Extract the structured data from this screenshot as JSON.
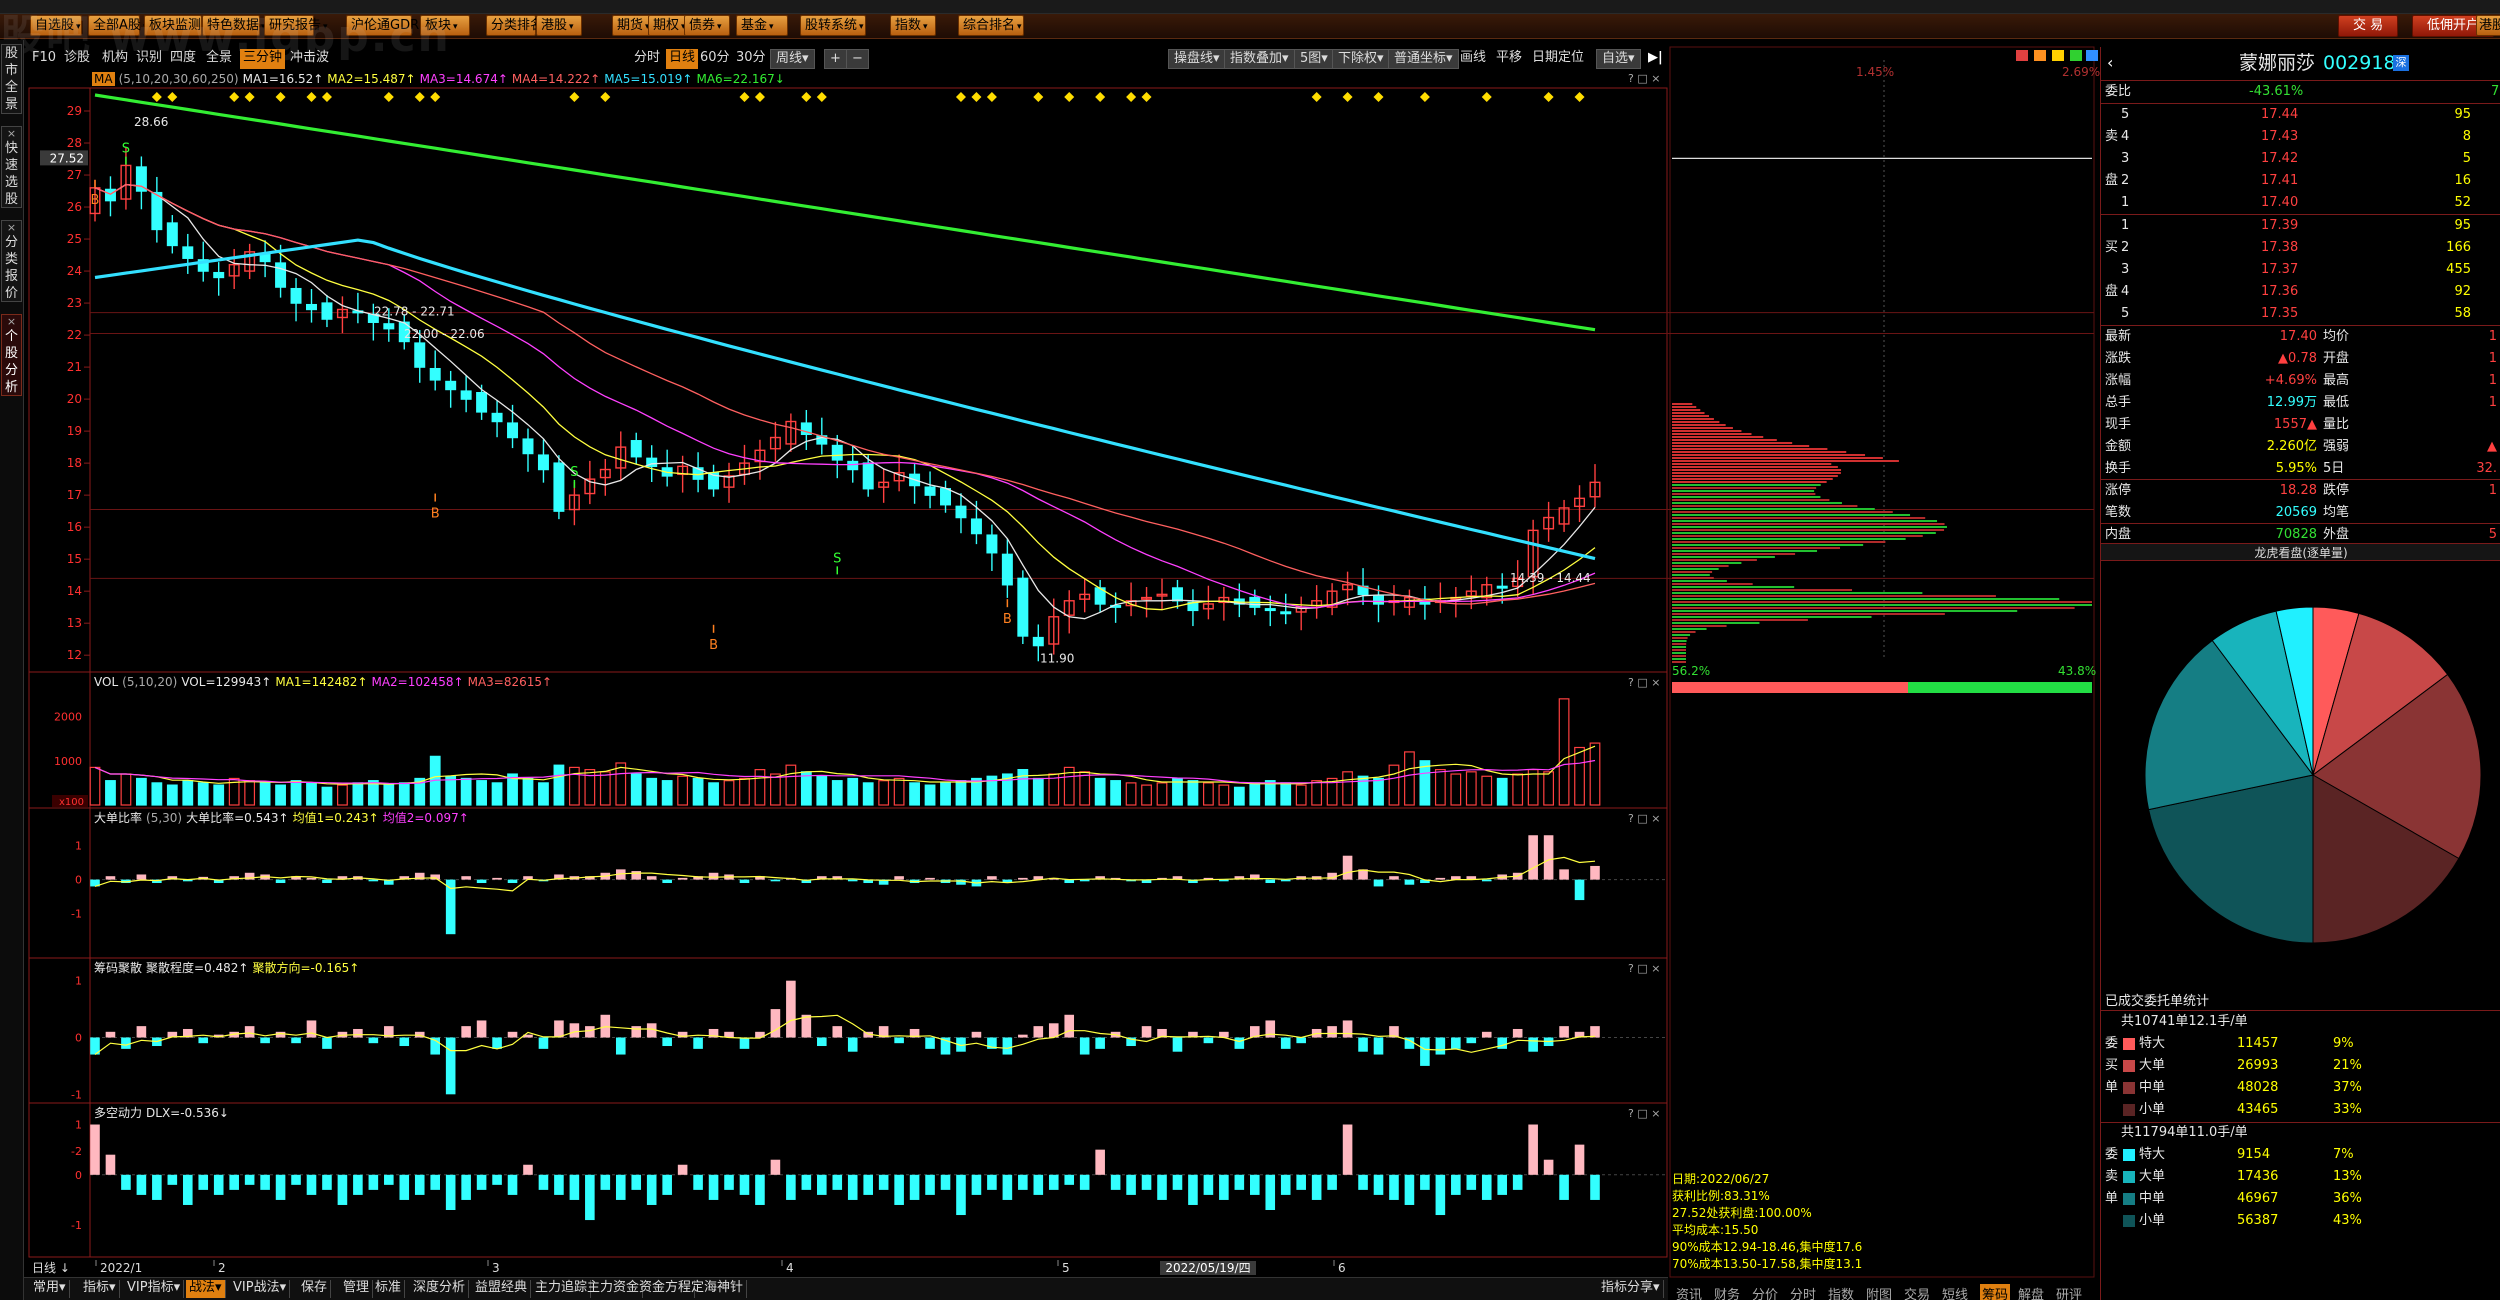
{
  "watermark": "股吧 www.jgpp.cn",
  "menu": [
    "自选股",
    "全部A股",
    "板块监测",
    "特色数据",
    "研究报告",
    "沪伦通GDR",
    "板块",
    "分类排名",
    "港股",
    "期货",
    "期权",
    "债券",
    "基金",
    "股转系统",
    "指数",
    "综合排名"
  ],
  "menu_right": {
    "trade": "交 易",
    "open_account": "低佣开户",
    "more": "港股"
  },
  "left_tabs": [
    "股市全景",
    "快速选股",
    "分类报价",
    "个股分析"
  ],
  "toolbar": {
    "left": [
      "F10",
      "诊股",
      "机构",
      "识别",
      "四度",
      "全景",
      "三分钟",
      "冲击波"
    ],
    "periods": [
      "分时",
      "日线",
      "60分",
      "30分",
      "周线"
    ],
    "zoom": [
      "+",
      "−"
    ],
    "right": [
      "操盘线",
      "指数叠加",
      "5图",
      "下除权",
      "普通坐标",
      "画线",
      "平移",
      "日期定位",
      "自选"
    ]
  },
  "ma_legend": {
    "label": "MA",
    "params": "(5,10,20,30,60,250)",
    "items": [
      {
        "text": "MA1=16.52↑",
        "color": "#e8e8e8"
      },
      {
        "text": "MA2=15.487↑",
        "color": "#ffff40"
      },
      {
        "text": "MA3=14.674↑",
        "color": "#ff40ff"
      },
      {
        "text": "MA4=14.222↑",
        "color": "#ff6060"
      },
      {
        "text": "MA5=15.019↑",
        "color": "#33e0ff"
      },
      {
        "text": "MA6=22.167↓",
        "color": "#33ee33"
      }
    ]
  },
  "vol_legend": {
    "label": "VOL",
    "params": "(5,10,20)",
    "items": [
      {
        "text": "VOL=129943↑",
        "color": "#e8e8e8"
      },
      {
        "text": "MA1=142482↑",
        "color": "#ffff40"
      },
      {
        "text": "MA2=102458↑",
        "color": "#ff40ff"
      },
      {
        "text": "MA3=82615↑",
        "color": "#ff6060"
      }
    ]
  },
  "big_legend": {
    "label": "大单比率",
    "params": "(5,30)",
    "items": [
      {
        "text": "大单比率=0.543↑",
        "color": "#e8e8e8"
      },
      {
        "text": "均值1=0.243↑",
        "color": "#ffff40"
      },
      {
        "text": "均值2=0.097↑",
        "color": "#ff40ff"
      }
    ]
  },
  "chip_legend": {
    "label": "筹码聚散",
    "params": "",
    "items": [
      {
        "text": "聚散程度=0.482↑",
        "color": "#e8e8e8"
      },
      {
        "text": "聚散方向=-0.165↑",
        "color": "#ffff40"
      }
    ]
  },
  "dlx_legend": {
    "label": "多空动力",
    "params": "",
    "items": [
      {
        "text": "DLX=-0.536↓",
        "color": "#e8e8e8"
      }
    ]
  },
  "price_axis": {
    "min": 11.6,
    "max": 29.5,
    "ticks": [
      12,
      13,
      14,
      15,
      16,
      17,
      18,
      19,
      20,
      21,
      22,
      23,
      24,
      25,
      26,
      27,
      28,
      29
    ],
    "current_label": "27.52"
  },
  "vol_axis": {
    "ticks": [
      "2000",
      "1000"
    ],
    "unit": "x100"
  },
  "big_axis": {
    "ticks": [
      "1",
      "0",
      "-1"
    ]
  },
  "chip_axis": {
    "ticks": [
      "1",
      "0",
      "-1",
      "-2"
    ]
  },
  "dlx_axis": {
    "ticks": [
      "1",
      "0",
      "-1"
    ]
  },
  "price_annotations": [
    "28.66",
    "22.78 - 22.71",
    "22.00 - 22.06",
    "14.39 - 14.44",
    "11.90"
  ],
  "signals": [
    "B",
    "S",
    "B",
    "S",
    "B",
    "S",
    "B"
  ],
  "x_axis": {
    "period": "日线",
    "labels": [
      "2022/1",
      "2",
      "3",
      "4",
      "5",
      "6"
    ],
    "cursor_date": "2022/05/19/四"
  },
  "panel_tools": "? □ ×",
  "bottom_tabs": [
    "常用",
    "指标",
    "VIP指标",
    "战法",
    "VIP战法",
    "保存",
    "管理",
    "标准",
    "深度分析",
    "益盟经典",
    "主力追踪",
    "主力资金",
    "资金方程",
    "定海神针",
    "指标分享"
  ],
  "mid_panel": {
    "top_pct_left": "1.45%",
    "top_pct_right": "2.69%",
    "bottom_pct_left": "56.2%",
    "bottom_pct_right": "43.8%",
    "info": [
      "日期:2022/06/27",
      "获利比例:83.31%",
      "27.52处获利盘:100.00%",
      "平均成本:15.50",
      "90%成本12.94-18.46,集中度17.6",
      "70%成本13.50-17.58,集中度13.1"
    ],
    "tabs": [
      "资讯",
      "财务",
      "分价",
      "分时",
      "指数",
      "附图",
      "交易",
      "短线",
      "筹码",
      "解盘",
      "研评"
    ]
  },
  "stock": {
    "name": "蒙娜丽莎",
    "code": "002918",
    "weibi_label": "委比",
    "weibi": "-43.61%",
    "weicha": "7",
    "asks": [
      {
        "n": "5",
        "p": "17.44",
        "v": "95"
      },
      {
        "n": "4",
        "p": "17.43",
        "v": "8"
      },
      {
        "n": "3",
        "p": "17.42",
        "v": "5"
      },
      {
        "n": "2",
        "p": "17.41",
        "v": "16"
      },
      {
        "n": "1",
        "p": "17.40",
        "v": "52"
      }
    ],
    "bids": [
      {
        "n": "1",
        "p": "17.39",
        "v": "95"
      },
      {
        "n": "2",
        "p": "17.38",
        "v": "166"
      },
      {
        "n": "3",
        "p": "17.37",
        "v": "455"
      },
      {
        "n": "4",
        "p": "17.36",
        "v": "92"
      },
      {
        "n": "5",
        "p": "17.35",
        "v": "58"
      }
    ],
    "ask_side": [
      "卖",
      "盘"
    ],
    "bid_side": [
      "买",
      "盘"
    ],
    "stats": [
      {
        "l": "最新",
        "v": "17.40",
        "c": "red",
        "l2": "均价",
        "v2": "1"
      },
      {
        "l": "涨跌",
        "v": "▲0.78",
        "c": "red",
        "l2": "开盘",
        "v2": "1"
      },
      {
        "l": "涨幅",
        "v": "+4.69%",
        "c": "red",
        "l2": "最高",
        "v2": "1"
      },
      {
        "l": "总手",
        "v": "12.99万",
        "c": "cyn",
        "l2": "最低",
        "v2": "1"
      },
      {
        "l": "现手",
        "v": "1557▲",
        "c": "red",
        "l2": "量比",
        "v2": ""
      },
      {
        "l": "金额",
        "v": "2.260亿",
        "c": "yel",
        "l2": "强弱",
        "v2": "▲"
      },
      {
        "l": "换手",
        "v": "5.95%",
        "c": "yel",
        "l2": "5日",
        "v2": "32."
      },
      {
        "l": "涨停",
        "v": "18.28",
        "c": "red",
        "l2": "跌停",
        "v2": "1"
      },
      {
        "l": "笔数",
        "v": "20569",
        "c": "cyn",
        "l2": "均笔",
        "v2": ""
      },
      {
        "l": "内盘",
        "v": "70828",
        "c": "grn",
        "l2": "外盘",
        "v2": "5"
      }
    ],
    "pie_title": "龙虎看盘(逐单量)",
    "order_title": "已成交委托单统计",
    "buy_total": "共10741单12.1手/单",
    "sell_total": "共11794单11.0手/单",
    "buy_side": [
      "委",
      "买",
      "单"
    ],
    "sell_side": [
      "委",
      "卖",
      "单"
    ],
    "buy_orders": [
      {
        "l": "特大",
        "v": "11457",
        "p": "9%",
        "color": "#ff5a5a"
      },
      {
        "l": "大单",
        "v": "26993",
        "p": "21%",
        "color": "#c84848"
      },
      {
        "l": "中单",
        "v": "48028",
        "p": "37%",
        "color": "#8a3434"
      },
      {
        "l": "小单",
        "v": "43465",
        "p": "33%",
        "color": "#5a2424"
      }
    ],
    "sell_orders": [
      {
        "l": "特大",
        "v": "9154",
        "p": "7%",
        "color": "#20f0ff"
      },
      {
        "l": "大单",
        "v": "17436",
        "p": "13%",
        "color": "#18b4bc"
      },
      {
        "l": "中单",
        "v": "46967",
        "p": "36%",
        "color": "#157e84"
      },
      {
        "l": "小单",
        "v": "56387",
        "p": "43%",
        "color": "#0f5458"
      }
    ]
  },
  "chart_data": [
    {
      "type": "candlestick",
      "title": "",
      "x_labels": [
        "2022/1",
        "2",
        "3",
        "4",
        "5",
        "6"
      ],
      "ylim": [
        11.6,
        29.5
      ],
      "ma_series": [
        {
          "name": "MA1",
          "last": 16.52
        },
        {
          "name": "MA2",
          "last": 15.487
        },
        {
          "name": "MA3",
          "last": 14.674
        },
        {
          "name": "MA4",
          "last": 14.222
        },
        {
          "name": "MA5",
          "last": 15.019
        },
        {
          "name": "MA6",
          "last": 22.167
        }
      ],
      "close": [
        26.6,
        26.2,
        27.3,
        26.5,
        25.3,
        24.8,
        24.4,
        24.0,
        23.8,
        24.2,
        24.6,
        24.3,
        23.5,
        23.0,
        22.8,
        22.5,
        22.8,
        22.7,
        22.4,
        22.2,
        21.8,
        21.0,
        20.6,
        20.3,
        20.0,
        19.6,
        19.3,
        18.8,
        18.3,
        17.8,
        16.5,
        17.0,
        17.5,
        17.8,
        18.5,
        18.2,
        17.9,
        17.6,
        17.9,
        17.5,
        17.2,
        17.6,
        18.0,
        18.4,
        18.8,
        19.3,
        18.9,
        18.6,
        18.1,
        17.8,
        17.2,
        17.4,
        17.7,
        17.3,
        17.0,
        16.7,
        16.3,
        15.8,
        15.2,
        14.2,
        12.6,
        12.3,
        13.2,
        13.7,
        13.9,
        13.6,
        13.5,
        13.7,
        13.8,
        13.9,
        13.7,
        13.4,
        13.6,
        13.8,
        13.6,
        13.5,
        13.4,
        13.3,
        13.5,
        13.7,
        14.0,
        14.2,
        13.9,
        13.6,
        13.7,
        13.8,
        13.6,
        13.7,
        13.8,
        14.0,
        14.2,
        14.1,
        14.4,
        15.9,
        16.3,
        16.6,
        16.9,
        17.4
      ]
    },
    {
      "type": "bar",
      "name": "VOL",
      "values": [
        85,
        55,
        70,
        60,
        50,
        45,
        55,
        50,
        45,
        60,
        55,
        50,
        45,
        55,
        50,
        40,
        45,
        50,
        55,
        45,
        50,
        60,
        110,
        65,
        60,
        55,
        50,
        70,
        60,
        50,
        90,
        85,
        80,
        75,
        95,
        70,
        60,
        55,
        65,
        60,
        50,
        55,
        60,
        80,
        70,
        90,
        75,
        65,
        55,
        60,
        50,
        55,
        60,
        50,
        45,
        50,
        55,
        60,
        65,
        70,
        80,
        60,
        70,
        85,
        75,
        60,
        55,
        50,
        45,
        50,
        60,
        55,
        50,
        45,
        40,
        50,
        55,
        50,
        45,
        55,
        60,
        75,
        65,
        60,
        90,
        120,
        100,
        80,
        70,
        75,
        65,
        60,
        70,
        80,
        75,
        240,
        130,
        140
      ],
      "unit": "x100"
    },
    {
      "type": "bar",
      "name": "大单比率",
      "values": [
        -0.2,
        0.1,
        -0.1,
        0.15,
        -0.1,
        0.1,
        -0.05,
        0.08,
        -0.1,
        0.1,
        0.2,
        0.15,
        -0.1,
        0.1,
        0.05,
        -0.1,
        0.1,
        0.1,
        -0.05,
        -0.15,
        0.1,
        0.2,
        0.15,
        -1.6,
        0.1,
        -0.1,
        0.05,
        -0.1,
        0.1,
        -0.05,
        0.15,
        0.1,
        0.1,
        0.2,
        0.3,
        0.25,
        0.1,
        -0.1,
        0.05,
        0.1,
        0.2,
        0.15,
        -0.1,
        0.1,
        -0.05,
        0.05,
        -0.1,
        0.1,
        0.1,
        -0.05,
        -0.1,
        -0.15,
        0.1,
        -0.1,
        0.05,
        -0.1,
        -0.15,
        -0.2,
        0.1,
        -0.1,
        0.05,
        0.1,
        0.05,
        -0.1,
        -0.05,
        0.1,
        0.05,
        -0.05,
        -0.1,
        0.05,
        0.1,
        -0.1,
        0.05,
        -0.05,
        0.1,
        0.15,
        -0.1,
        -0.05,
        0.1,
        0.1,
        0.2,
        0.7,
        0.3,
        -0.2,
        0.1,
        -0.15,
        -0.1,
        0.05,
        0.1,
        0.1,
        -0.05,
        0.15,
        0.2,
        1.3,
        1.3,
        0.3,
        -0.6,
        0.4
      ]
    },
    {
      "type": "bar",
      "name": "筹码聚散",
      "values": [
        -0.3,
        0.1,
        -0.2,
        0.2,
        -0.15,
        0.1,
        0.15,
        -0.1,
        0.05,
        0.1,
        0.2,
        -0.1,
        0.1,
        -0.1,
        0.3,
        -0.2,
        0.1,
        0.15,
        -0.1,
        0.2,
        -0.15,
        0.1,
        -0.3,
        -1.0,
        0.2,
        0.3,
        -0.2,
        0.1,
        0.05,
        -0.2,
        0.3,
        0.25,
        0.2,
        0.4,
        -0.3,
        0.2,
        0.25,
        -0.15,
        0.1,
        -0.2,
        0.15,
        0.1,
        -0.2,
        0.1,
        0.5,
        1.0,
        0.4,
        -0.15,
        0.2,
        -0.25,
        0.1,
        0.2,
        -0.1,
        0.15,
        -0.2,
        -0.3,
        -0.25,
        0.1,
        -0.2,
        -0.3,
        0.05,
        0.2,
        0.25,
        0.4,
        -0.3,
        -0.2,
        0.1,
        -0.15,
        0.2,
        0.15,
        -0.25,
        0.1,
        -0.1,
        0.1,
        -0.2,
        0.2,
        0.3,
        -0.2,
        -0.1,
        0.15,
        0.2,
        0.3,
        -0.25,
        -0.3,
        0.2,
        -0.2,
        -0.5,
        -0.3,
        -0.2,
        -0.1,
        0.1,
        -0.2,
        0.15,
        -0.25,
        -0.15,
        0.2,
        0.1,
        0.2
      ]
    },
    {
      "type": "bar",
      "name": "DLX",
      "values": [
        1.0,
        0.4,
        -0.3,
        -0.4,
        -0.5,
        -0.2,
        -0.6,
        -0.3,
        -0.4,
        -0.3,
        -0.2,
        -0.3,
        -0.5,
        -0.2,
        -0.4,
        -0.3,
        -0.6,
        -0.4,
        -0.3,
        -0.2,
        -0.5,
        -0.4,
        -0.3,
        -0.7,
        -0.5,
        -0.3,
        -0.2,
        -0.4,
        0.2,
        -0.3,
        -0.4,
        -0.5,
        -0.9,
        -0.3,
        -0.5,
        -0.3,
        -0.6,
        -0.4,
        0.2,
        -0.3,
        -0.5,
        -0.3,
        -0.4,
        -0.6,
        0.3,
        -0.5,
        -0.3,
        -0.4,
        -0.3,
        -0.5,
        -0.4,
        -0.3,
        -0.6,
        -0.5,
        -0.4,
        -0.3,
        -0.8,
        -0.4,
        -0.3,
        -0.5,
        -0.3,
        -0.4,
        -0.3,
        -0.2,
        -0.3,
        0.5,
        -0.3,
        -0.4,
        -0.3,
        -0.5,
        -0.3,
        -0.6,
        -0.4,
        -0.5,
        -0.3,
        -0.4,
        -0.7,
        -0.4,
        -0.3,
        -0.5,
        -0.3,
        1.0,
        -0.3,
        -0.4,
        -0.5,
        -0.6,
        -0.3,
        -0.8,
        -0.4,
        -0.3,
        -0.5,
        -0.4,
        -0.3,
        1.0,
        0.3,
        -0.5,
        0.6,
        -0.5
      ]
    }
  ]
}
